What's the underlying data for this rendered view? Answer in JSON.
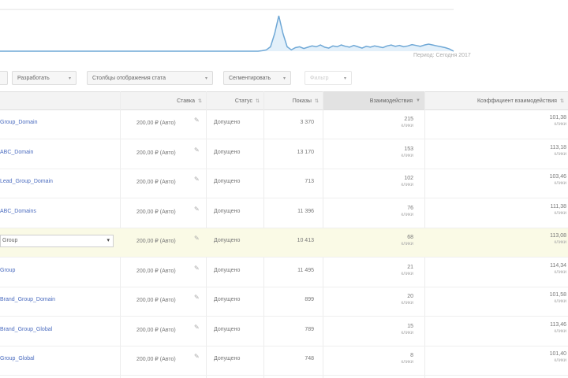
{
  "chart": {
    "caption": "Период: Сегодня 2017",
    "line_color": "#6fa8d6",
    "values": [
      0,
      0,
      0,
      0,
      0,
      0,
      0,
      0,
      0,
      0,
      0,
      0,
      0,
      0,
      0,
      0,
      0,
      0,
      0,
      0,
      0,
      0,
      0,
      0,
      0,
      0,
      0,
      0,
      0,
      0,
      0,
      0,
      0,
      0,
      0,
      0,
      0,
      0,
      0,
      0,
      0,
      0,
      0,
      0,
      0,
      0,
      0,
      0,
      0,
      0,
      0,
      0,
      0,
      0,
      0,
      0,
      0,
      0,
      0,
      0,
      0,
      0,
      0,
      1,
      3,
      10,
      40,
      80,
      40,
      10,
      3,
      8,
      10,
      6,
      9,
      12,
      10,
      14,
      9,
      7,
      12,
      10,
      14,
      11,
      9,
      13,
      10,
      7,
      11,
      9,
      12,
      10,
      8,
      12,
      14,
      11,
      13,
      10,
      12,
      15,
      13,
      11,
      14,
      16,
      14,
      12,
      10,
      8,
      5,
      0
    ]
  },
  "filters": [
    {
      "label": "Разработать",
      "disabled": false
    },
    {
      "label": "Столбцы отображения стата",
      "disabled": false
    },
    {
      "label": "Сегментировать",
      "disabled": false
    },
    {
      "label": "Фильтр",
      "disabled": true
    }
  ],
  "columns": {
    "bid": "Ставка",
    "status": "Статус",
    "impressions": "Показы",
    "clicks": "Взаимодействия",
    "conversions": "Коэффициент взаимодействия"
  },
  "rows": [
    {
      "name": "Group_Domain",
      "bid": "200,00 ₽ (Авто)",
      "status": "Допущено",
      "impressions": "3 370",
      "clicks": "215",
      "clicks_sub": "клики",
      "conv": "101,38",
      "conv_sub": "клики",
      "highlight": false,
      "editing": false
    },
    {
      "name": "ABC_Domain",
      "bid": "200,00 ₽ (Авто)",
      "status": "Допущено",
      "impressions": "13 170",
      "clicks": "153",
      "clicks_sub": "клики",
      "conv": "113,18",
      "conv_sub": "клики",
      "highlight": false,
      "editing": false
    },
    {
      "name": "Lead_Group_Domain",
      "bid": "200,00 ₽ (Авто)",
      "status": "Допущено",
      "impressions": "713",
      "clicks": "102",
      "clicks_sub": "клики",
      "conv": "103,46",
      "conv_sub": "клики",
      "highlight": false,
      "editing": false
    },
    {
      "name": "ABC_Domains",
      "bid": "200,00 ₽ (Авто)",
      "status": "Допущено",
      "impressions": "11 396",
      "clicks": "76",
      "clicks_sub": "клики",
      "conv": "111,38",
      "conv_sub": "клики",
      "highlight": false,
      "editing": false
    },
    {
      "name": "Group",
      "bid": "200,00 ₽ (Авто)",
      "status": "Допущено",
      "impressions": "10 413",
      "clicks": "68",
      "clicks_sub": "клики",
      "conv": "113,08",
      "conv_sub": "клики",
      "highlight": true,
      "editing": true
    },
    {
      "name": "Group",
      "bid": "200,00 ₽ (Авто)",
      "status": "Допущено",
      "impressions": "11 495",
      "clicks": "21",
      "clicks_sub": "клики",
      "conv": "114,34",
      "conv_sub": "клики",
      "highlight": false,
      "editing": false
    },
    {
      "name": "Brand_Group_Domain",
      "bid": "200,00 ₽ (Авто)",
      "status": "Допущено",
      "impressions": "899",
      "clicks": "20",
      "clicks_sub": "клики",
      "conv": "101,58",
      "conv_sub": "клики",
      "highlight": false,
      "editing": false
    },
    {
      "name": "Brand_Group_Global",
      "bid": "200,00 ₽ (Авто)",
      "status": "Допущено",
      "impressions": "789",
      "clicks": "15",
      "clicks_sub": "клики",
      "conv": "113,46",
      "conv_sub": "клики",
      "highlight": false,
      "editing": false
    },
    {
      "name": "Group_Global",
      "bid": "200,00 ₽ (Авто)",
      "status": "Допущено",
      "impressions": "748",
      "clicks": "8",
      "clicks_sub": "клики",
      "conv": "101,40",
      "conv_sub": "клики",
      "highlight": false,
      "editing": false
    }
  ]
}
